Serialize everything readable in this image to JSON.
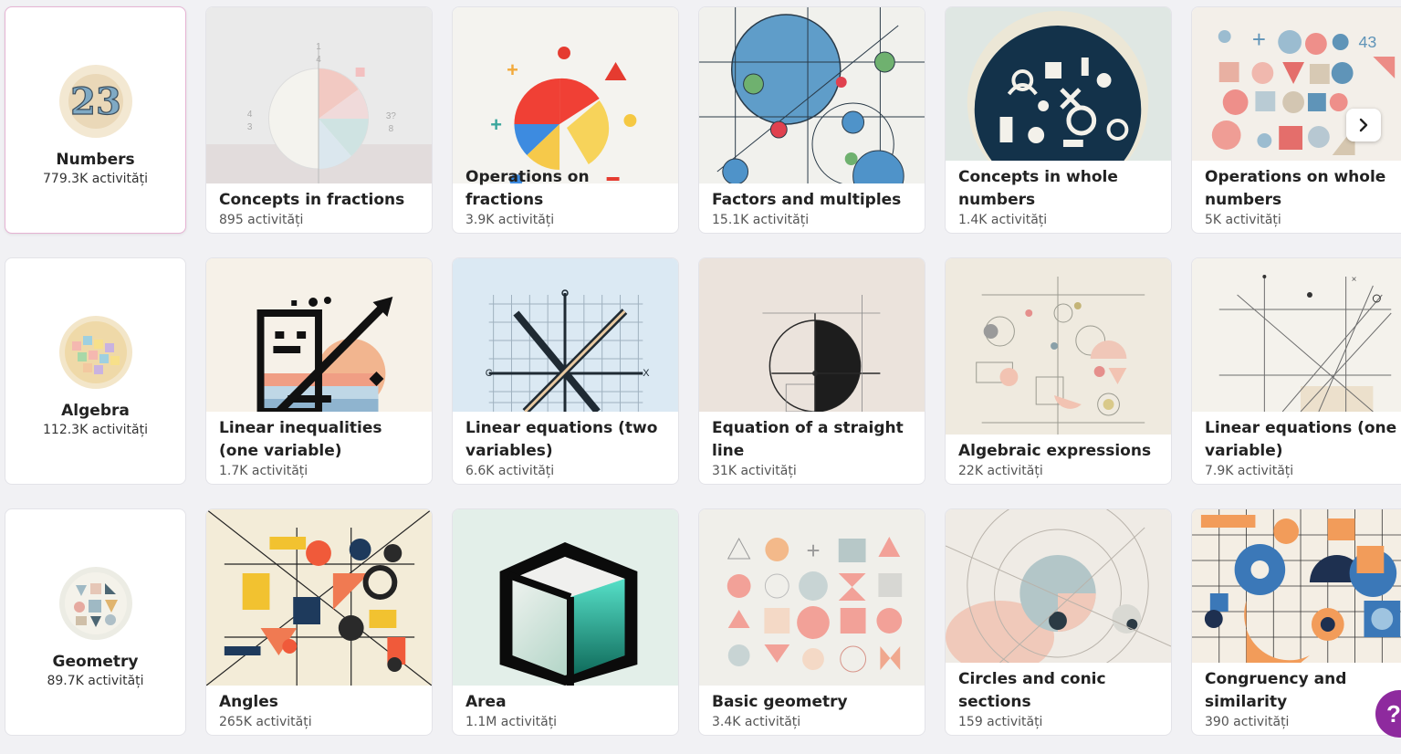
{
  "rows": [
    {
      "category": {
        "title": "Numbers",
        "count": "779.3K activități",
        "icon": "numbers-icon"
      },
      "tiles": [
        {
          "title": "Concepts in fractions",
          "count": "895 activități"
        },
        {
          "title": "Operations on fractions",
          "count": "3.9K activități"
        },
        {
          "title": "Factors and multiples",
          "count": "15.1K activități"
        },
        {
          "title": "Concepts in whole numbers",
          "count": "1.4K activități"
        },
        {
          "title": "Operations on whole numbers",
          "count": "5K activități"
        }
      ]
    },
    {
      "category": {
        "title": "Algebra",
        "count": "112.3K activități",
        "icon": "algebra-icon"
      },
      "tiles": [
        {
          "title": "Linear inequalities (one variable)",
          "count": "1.7K activități"
        },
        {
          "title": "Linear equations (two variables)",
          "count": "6.6K activități"
        },
        {
          "title": "Equation of a straight line",
          "count": "31K activități"
        },
        {
          "title": "Algebraic expressions",
          "count": "22K activități"
        },
        {
          "title": "Linear equations (one variable)",
          "count": "7.9K activități"
        }
      ]
    },
    {
      "category": {
        "title": "Geometry",
        "count": "89.7K activități",
        "icon": "geometry-icon"
      },
      "tiles": [
        {
          "title": "Angles",
          "count": "265K activități"
        },
        {
          "title": "Area",
          "count": "1.1M activități"
        },
        {
          "title": "Basic geometry",
          "count": "3.4K activități"
        },
        {
          "title": "Circles and conic sections",
          "count": "159 activități"
        },
        {
          "title": "Congruency and similarity",
          "count": "390 activități"
        }
      ]
    }
  ],
  "thumb_text": {
    "fraction_top": "1",
    "fraction_bottom": "4",
    "fraction_left": "4",
    "fraction_left_bottom": "3",
    "fraction_right": "3?",
    "fraction_right_bottom": "8",
    "corner_number": "43",
    "axis_x": "X",
    "axis_c": "C"
  },
  "controls": {
    "next_icon": "chevron-right-icon",
    "help_label": "?"
  },
  "colors": {
    "selected_border": "#e6b3d3",
    "help": "#8e2a9e",
    "card_bg": "#ffffff",
    "page_bg": "#f1f1f4"
  }
}
